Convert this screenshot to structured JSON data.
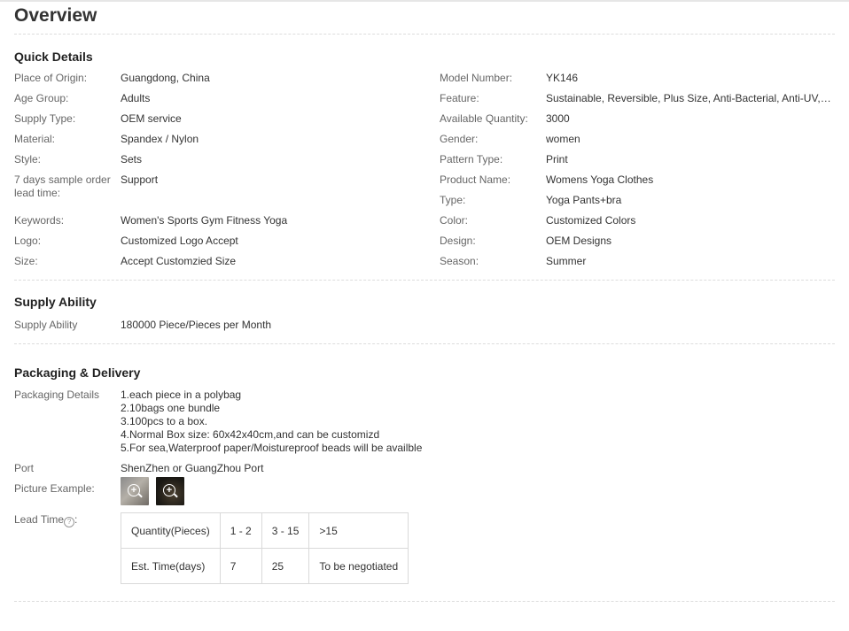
{
  "overview_title": "Overview",
  "quick_details": {
    "title": "Quick Details",
    "left": [
      {
        "label": "Place of Origin:",
        "value": "Guangdong, China"
      },
      {
        "label": "Age Group:",
        "value": "Adults"
      },
      {
        "label": "Supply Type:",
        "value": "OEM service"
      },
      {
        "label": "Material:",
        "value": "Spandex / Nylon"
      },
      {
        "label": "Style:",
        "value": "Sets"
      },
      {
        "label": "7 days sample order lead time:",
        "value": "Support"
      },
      {
        "label": "Keywords:",
        "value": "Women's Sports Gym Fitness Yoga"
      },
      {
        "label": "Logo:",
        "value": "Customized Logo Accept"
      },
      {
        "label": "Size:",
        "value": "Accept Customzied Size"
      }
    ],
    "right": [
      {
        "label": "Model Number:",
        "value": "YK146"
      },
      {
        "label": "Feature:",
        "value": "Sustainable, Reversible, Plus Size, Anti-Bacterial, Anti-UV, Ant…"
      },
      {
        "label": "Available Quantity:",
        "value": "3000"
      },
      {
        "label": "Gender:",
        "value": "women"
      },
      {
        "label": "Pattern Type:",
        "value": "Print"
      },
      {
        "label": "Product Name:",
        "value": "Womens Yoga Clothes"
      },
      {
        "label": "Type:",
        "value": "Yoga Pants+bra"
      },
      {
        "label": "Color:",
        "value": "Customized Colors"
      },
      {
        "label": "Design:",
        "value": "OEM Designs"
      },
      {
        "label": "Season:",
        "value": "Summer"
      }
    ]
  },
  "supply_ability": {
    "title": "Supply Ability",
    "label": "Supply Ability",
    "value": "180000 Piece/Pieces per Month"
  },
  "packaging": {
    "title": "Packaging & Delivery",
    "details_label": "Packaging Details",
    "details_lines": [
      "1.each piece in a polybag",
      "2.10bags one bundle",
      "3.100pcs to a box.",
      "4.Normal Box size: 60x42x40cm,and can be customizd",
      "5.For sea,Waterproof paper/Moistureproof beads will be availble"
    ],
    "port_label": "Port",
    "port_value": "ShenZhen or GuangZhou Port",
    "picture_label": "Picture Example:",
    "lead_time_label": "Lead Time",
    "lead_time_suffix": ":",
    "help_glyph": "?",
    "zoom_glyph": "+",
    "lead_time_table": {
      "header": [
        "Quantity(Pieces)",
        "1 - 2",
        "3 - 15",
        ">15"
      ],
      "row": [
        "Est. Time(days)",
        "7",
        "25",
        "To be negotiated"
      ]
    }
  },
  "colors": {
    "divider": "#dcdcdc",
    "label": "#666666",
    "value": "#333333",
    "table_border": "#d9d9d9"
  },
  "icons": {
    "picture_zoom": "zoom-in-icon",
    "help": "question-circle-icon"
  }
}
